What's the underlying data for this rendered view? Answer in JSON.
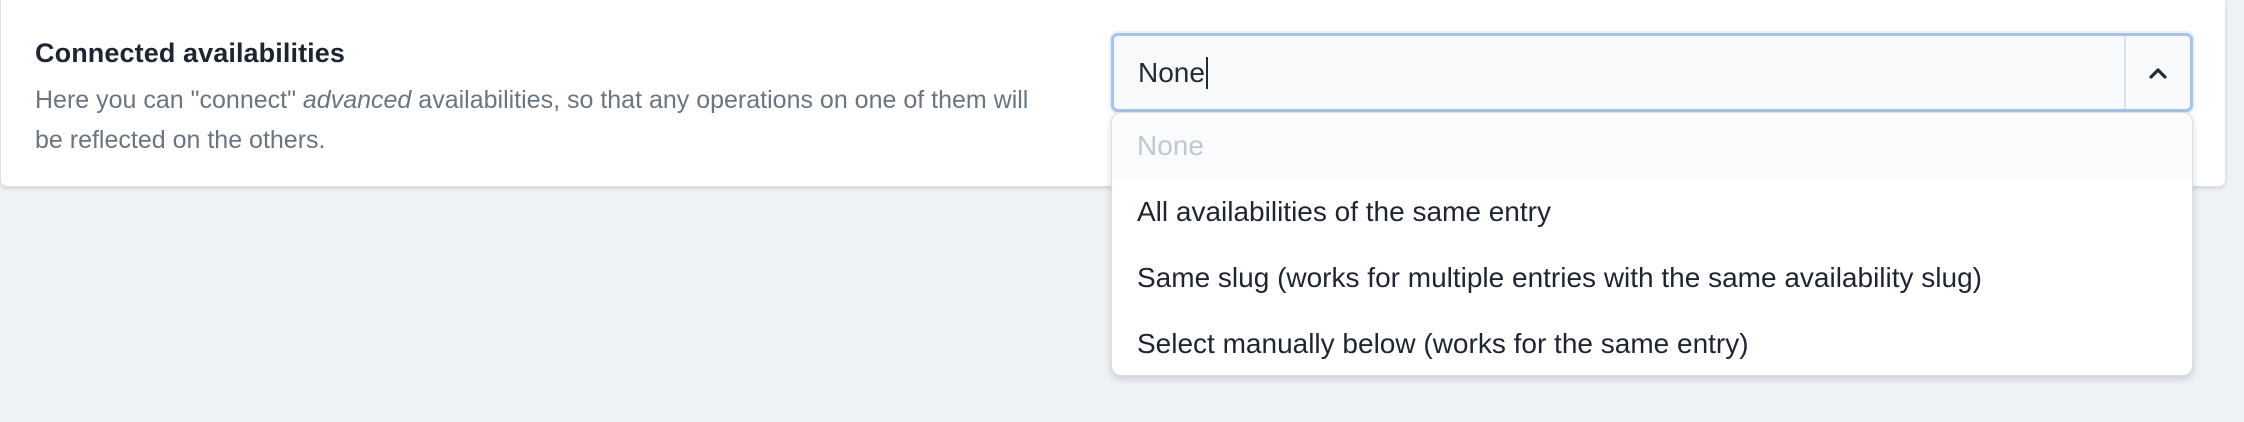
{
  "field": {
    "label": "Connected availabilities",
    "help_prefix": "Here you can \"connect\" ",
    "help_emphasis": "advanced",
    "help_suffix": " availabilities, so that any operations on one of them will be reflected on the others."
  },
  "select": {
    "value": "None",
    "toggle_icon": "chevron-up-icon",
    "open": true,
    "options": [
      {
        "label": "None",
        "disabled": true
      },
      {
        "label": "All availabilities of the same entry",
        "disabled": false
      },
      {
        "label": "Same slug (works for multiple entries with the same availability slug)",
        "disabled": false
      },
      {
        "label": "Select manually below (works for the same entry)",
        "disabled": false
      }
    ]
  },
  "colors": {
    "page_bg": "#eff2f5",
    "card_bg": "#ffffff",
    "focus_border": "#a7c4e8",
    "text_primary": "#1f2530",
    "text_muted": "#6b7580",
    "option_disabled": "#c3c8cf"
  }
}
